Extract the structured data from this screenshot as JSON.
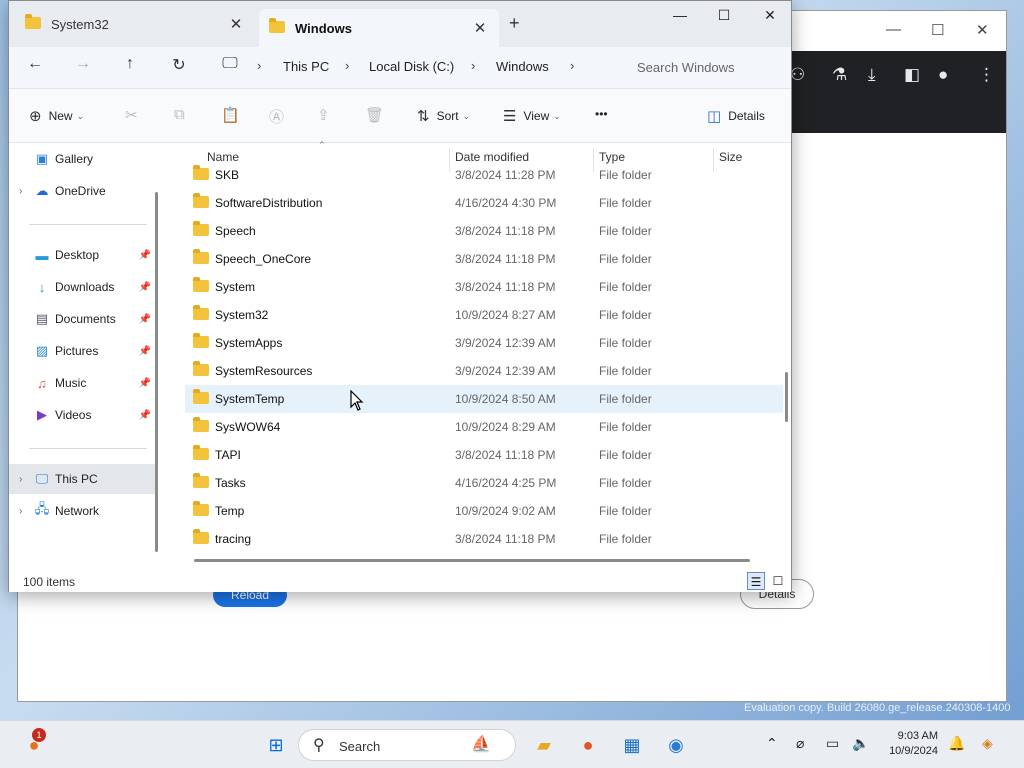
{
  "background_window": {
    "reload_label": "Reload",
    "details_label": "Details",
    "eval_text": "Evaluation copy. Build 26080.ge_release.240308-1400"
  },
  "explorer": {
    "tabs": [
      {
        "label": "System32",
        "active": false
      },
      {
        "label": "Windows",
        "active": true
      }
    ],
    "window_controls": {
      "minimize": "—",
      "maximize": "☐",
      "close": "✕"
    },
    "breadcrumb": [
      "This PC",
      "Local Disk (C:)",
      "Windows"
    ],
    "search_placeholder": "Search Windows",
    "command_bar": {
      "new_label": "New",
      "sort_label": "Sort",
      "view_label": "View",
      "more_label": "•••",
      "details_label": "Details"
    },
    "sidebar": {
      "gallery": "Gallery",
      "onedrive": "OneDrive",
      "desktop": "Desktop",
      "downloads": "Downloads",
      "documents": "Documents",
      "pictures": "Pictures",
      "music": "Music",
      "videos": "Videos",
      "this_pc": "This PC",
      "network": "Network"
    },
    "columns": {
      "name": "Name",
      "date": "Date modified",
      "type": "Type",
      "size": "Size"
    },
    "rows": [
      {
        "name": "SKB",
        "date": "3/8/2024 11:28 PM",
        "type": "File folder"
      },
      {
        "name": "SoftwareDistribution",
        "date": "4/16/2024 4:30 PM",
        "type": "File folder"
      },
      {
        "name": "Speech",
        "date": "3/8/2024 11:18 PM",
        "type": "File folder"
      },
      {
        "name": "Speech_OneCore",
        "date": "3/8/2024 11:18 PM",
        "type": "File folder"
      },
      {
        "name": "System",
        "date": "3/8/2024 11:18 PM",
        "type": "File folder"
      },
      {
        "name": "System32",
        "date": "10/9/2024 8:27 AM",
        "type": "File folder"
      },
      {
        "name": "SystemApps",
        "date": "3/9/2024 12:39 AM",
        "type": "File folder"
      },
      {
        "name": "SystemResources",
        "date": "3/9/2024 12:39 AM",
        "type": "File folder"
      },
      {
        "name": "SystemTemp",
        "date": "10/9/2024 8:50 AM",
        "type": "File folder"
      },
      {
        "name": "SysWOW64",
        "date": "10/9/2024 8:29 AM",
        "type": "File folder"
      },
      {
        "name": "TAPI",
        "date": "3/8/2024 11:18 PM",
        "type": "File folder"
      },
      {
        "name": "Tasks",
        "date": "4/16/2024 4:25 PM",
        "type": "File folder"
      },
      {
        "name": "Temp",
        "date": "10/9/2024 9:02 AM",
        "type": "File folder"
      },
      {
        "name": "tracing",
        "date": "3/8/2024 11:18 PM",
        "type": "File folder"
      }
    ],
    "status": "100 items"
  },
  "taskbar": {
    "search_label": "Search",
    "notification_count": "1",
    "time": "9:03 AM",
    "date": "10/9/2024"
  }
}
